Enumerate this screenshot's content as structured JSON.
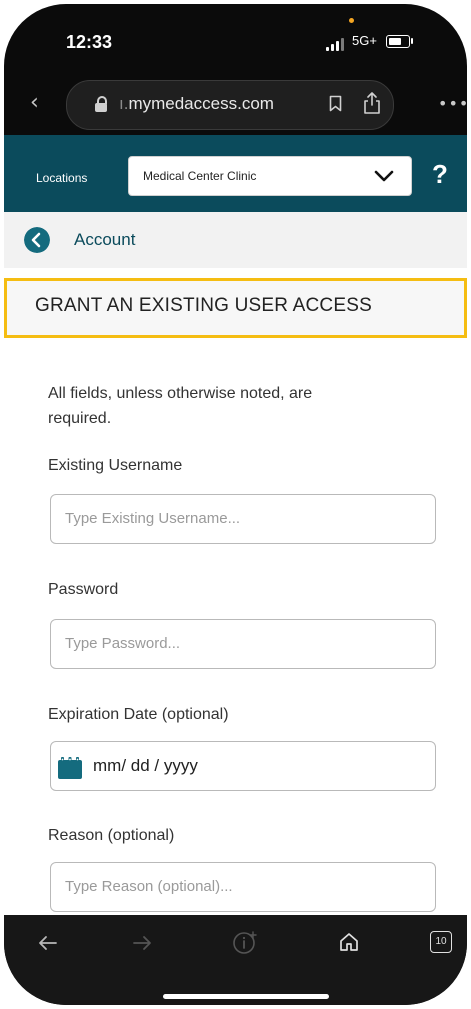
{
  "status_bar": {
    "time": "12:33",
    "network": "5G+"
  },
  "browser": {
    "url_prefix": "ı.",
    "url_domain": "mymedaccess.com",
    "icons": [
      "back-chevron-icon",
      "lock-icon",
      "bookmark-icon",
      "share-icon",
      "more-icon"
    ]
  },
  "locations": {
    "label": "Locations",
    "selected": "Medical Center Clinic",
    "help": "?"
  },
  "breadcrumb": {
    "label": "Account"
  },
  "page": {
    "title": "GRANT AN EXISTING USER ACCESS",
    "intro": "All fields, unless otherwise noted, are required."
  },
  "form": {
    "username": {
      "label": "Existing Username",
      "placeholder": "Type Existing Username..."
    },
    "password": {
      "label": "Password",
      "placeholder": "Type Password..."
    },
    "expiration": {
      "label": "Expiration Date (optional)",
      "value": "mm/ dd / yyyy"
    },
    "reason": {
      "label": "Reason (optional)",
      "placeholder": "Type Reason (optional)..."
    }
  },
  "toolbar": {
    "tab_count": "10",
    "icons": [
      "back-arrow-icon",
      "forward-arrow-icon",
      "reader-icon",
      "home-icon",
      "tabs-icon"
    ]
  },
  "colors": {
    "header_teal": "#0b4b5c",
    "accent_teal": "#146b7e",
    "highlight_yellow": "#f5bd12"
  }
}
